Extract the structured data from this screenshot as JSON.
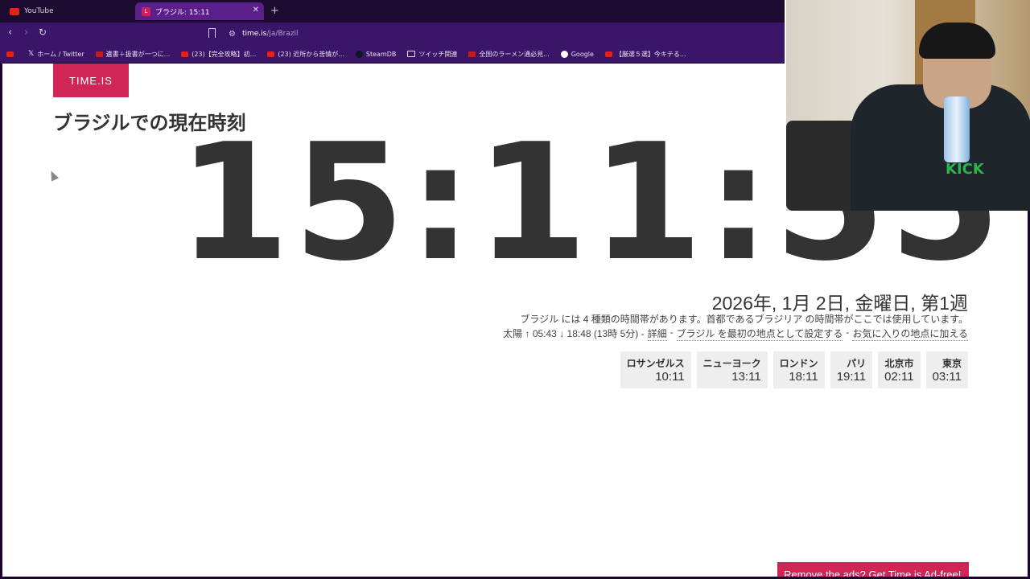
{
  "browser": {
    "tabs": [
      {
        "label": "YouTube",
        "active": false
      },
      {
        "label": "ブラジル: 15:11",
        "active": true
      }
    ],
    "new_tab": "+",
    "address": {
      "host": "time.is",
      "path": "/ja/Brazil"
    },
    "bookmarks": [
      {
        "label": "",
        "icon": "youtube-icon"
      },
      {
        "label": "ホーム / Twitter",
        "icon": "x-icon"
      },
      {
        "label": "遺書＋扱書が一つに...",
        "icon": "red-icon"
      },
      {
        "label": "(23)【完全攻略】初...",
        "icon": "youtube-icon"
      },
      {
        "label": "(23) 近所から苦情が...",
        "icon": "youtube-icon"
      },
      {
        "label": "SteamDB",
        "icon": "steam-icon"
      },
      {
        "label": "ツイッチ関連",
        "icon": "folder-icon"
      },
      {
        "label": "全国のラーメン通必見...",
        "icon": "red-icon"
      },
      {
        "label": "Google",
        "icon": "google-icon"
      },
      {
        "label": "【厳選５選】今キテる...",
        "icon": "youtube-icon"
      }
    ]
  },
  "page": {
    "logo": "TIME.IS",
    "title_bold": "ブラジル",
    "title_rest": "での現在時刻",
    "clock": "15:11:55",
    "date": "2026年, 1月 2日, 金曜日, 第1週",
    "tz_info": "ブラジル には 4 種類の時間帯があります。首都であるブラジリア の時間帯がここでは使用しています。",
    "sun": {
      "text": "太陽 ↑ 05:43 ↓ 18:48 (13時 5分) -",
      "details": "詳細",
      "sep1": "-",
      "set_first": "ブラジル を最初の地点として設定する",
      "sep2": "-",
      "add_fav": "お気に入りの地点に加える"
    },
    "cities": [
      {
        "name": "ロサンゼルス",
        "time": "10:11"
      },
      {
        "name": "ニューヨーク",
        "time": "13:11"
      },
      {
        "name": "ロンドン",
        "time": "18:11"
      },
      {
        "name": "パリ",
        "time": "19:11"
      },
      {
        "name": "北京市",
        "time": "02:11"
      },
      {
        "name": "東京",
        "time": "03:11"
      }
    ],
    "ad_banner": "Remove the ads? Get Time.is Ad-free!"
  },
  "webcam": {
    "shirt_text": "KICK"
  }
}
